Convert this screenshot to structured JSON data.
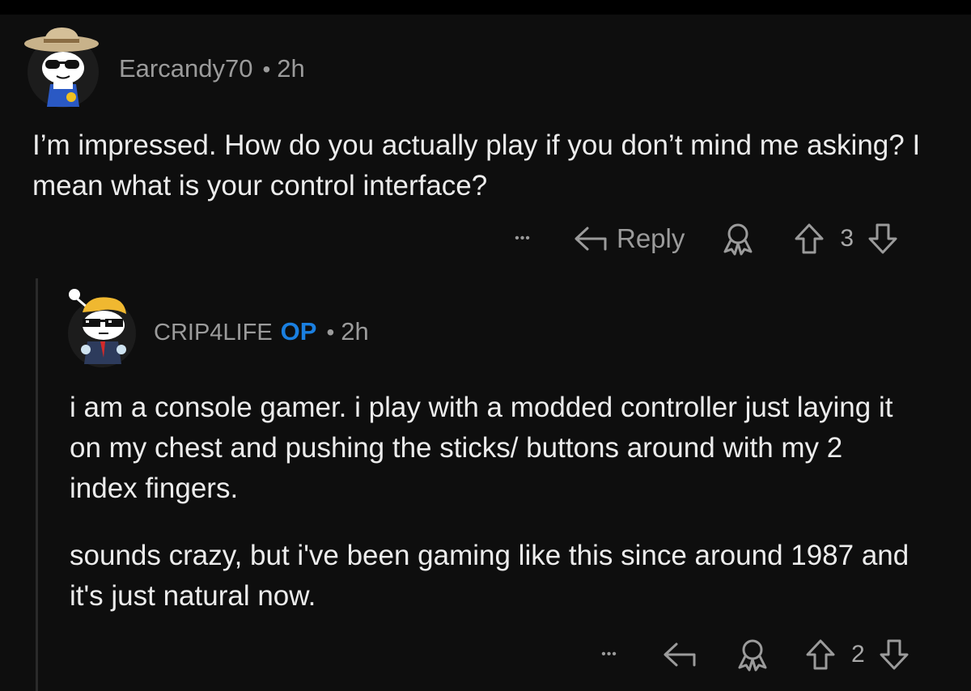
{
  "comments": [
    {
      "username": "Earcandy70",
      "separator": "•",
      "time": "2h",
      "body": [
        "I’m impressed. How do you actually play if you don’t mind me asking? I mean what is your control interface?"
      ],
      "actions": {
        "more": "•••",
        "reply_label": "Reply",
        "votes": "3"
      }
    },
    {
      "username": "CRIP4LIFE",
      "flair": "OP",
      "separator": "•",
      "time": "2h",
      "body": [
        "i am a console gamer. i play with a modded controller just laying it on my chest and pushing the sticks/ buttons around with my 2 index fingers.",
        "sounds crazy, but i've been gaming like this since around 1987 and it's just natural now."
      ],
      "actions": {
        "more": "•••",
        "votes": "2"
      }
    }
  ],
  "colors": {
    "background": "#0e0e0e",
    "op_flair": "#1a7fe0",
    "meta_text": "#9b9b9b",
    "body_text": "#ececec"
  }
}
